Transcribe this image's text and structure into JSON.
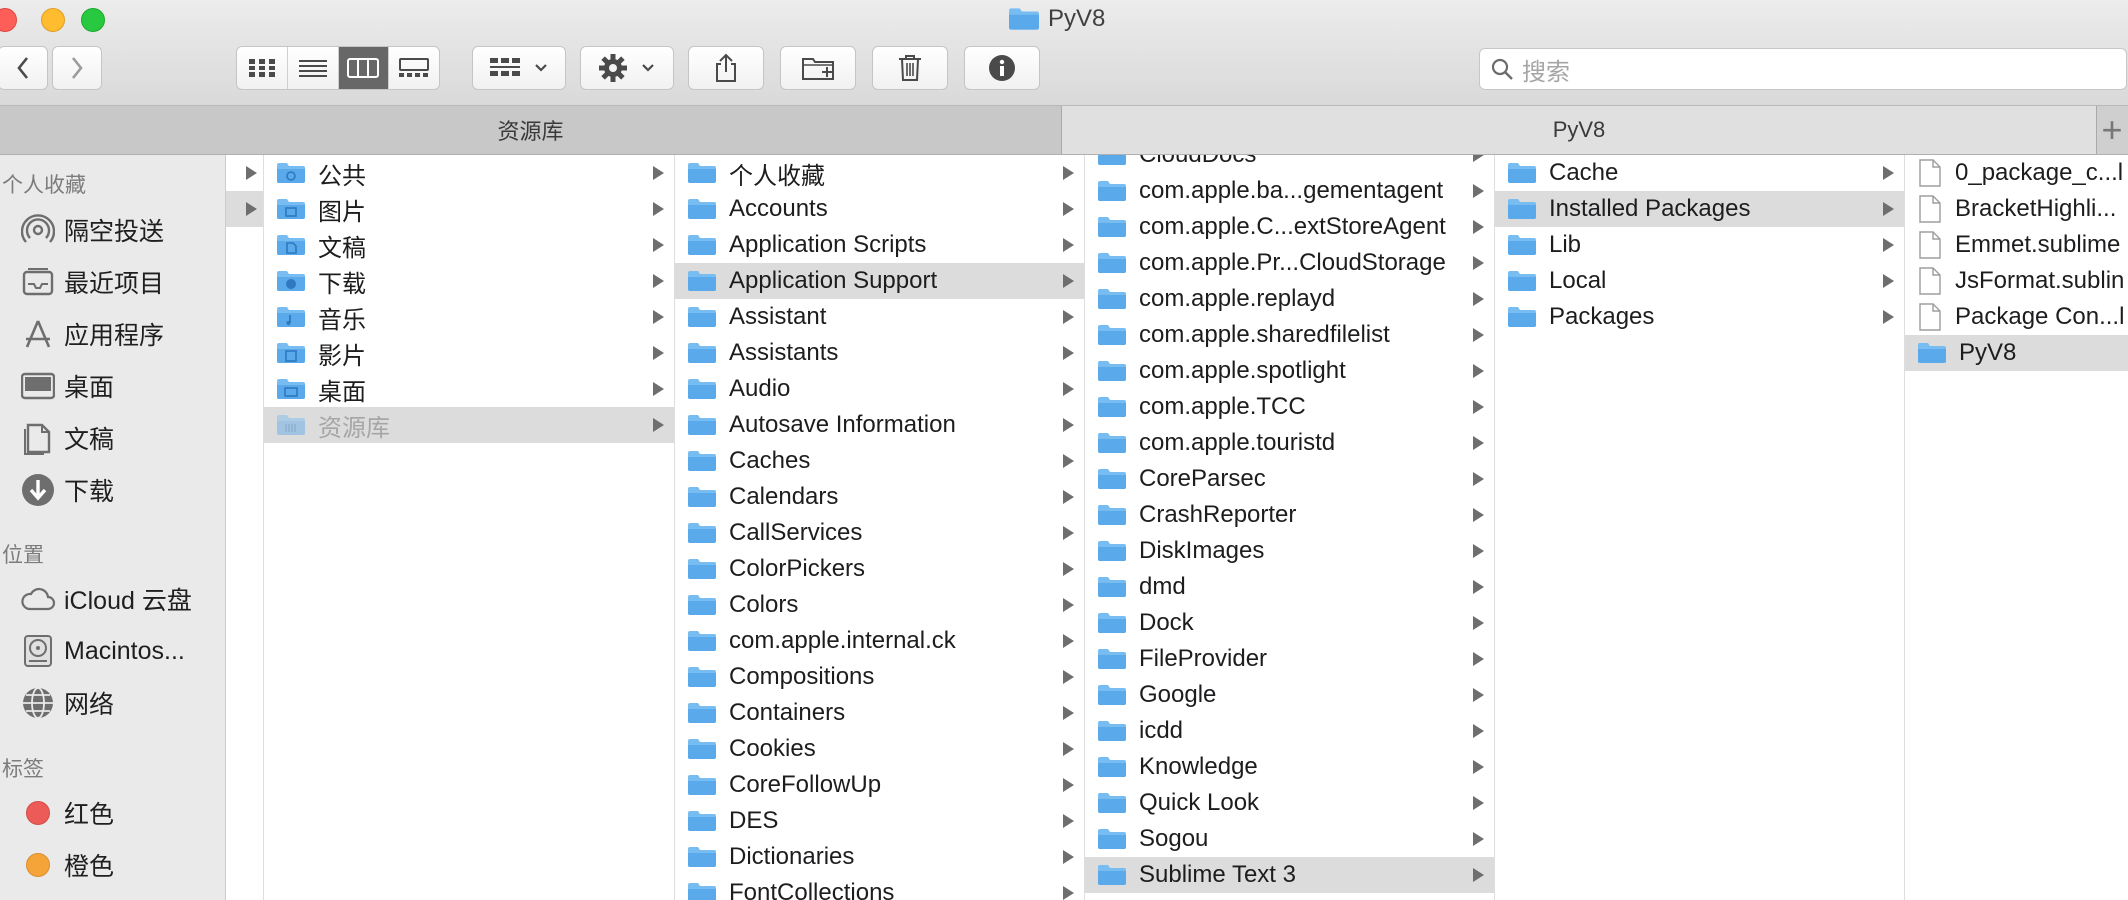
{
  "window": {
    "title": "PyV8"
  },
  "toolbar": {
    "view_modes": [
      "icon-view",
      "list-view",
      "column-view",
      "gallery-view"
    ],
    "active_view": "column-view",
    "search_placeholder": "搜索"
  },
  "tabs": [
    {
      "label": "资源库"
    },
    {
      "label": "PyV8"
    }
  ],
  "sidebar": {
    "favorites_title": "个人收藏",
    "favorites": [
      {
        "label": "隔空投送",
        "icon": "airdrop-icon"
      },
      {
        "label": "最近项目",
        "icon": "recents-icon"
      },
      {
        "label": "应用程序",
        "icon": "applications-icon"
      },
      {
        "label": "桌面",
        "icon": "desktop-icon"
      },
      {
        "label": "文稿",
        "icon": "documents-icon"
      },
      {
        "label": "下载",
        "icon": "downloads-icon"
      }
    ],
    "locations_title": "位置",
    "locations": [
      {
        "label": "iCloud 云盘",
        "icon": "icloud-icon"
      },
      {
        "label": "Macintos...",
        "icon": "harddisk-icon"
      },
      {
        "label": "网络",
        "icon": "network-icon"
      }
    ],
    "tags_title": "标签",
    "tags": [
      {
        "label": "红色",
        "color": "#ec5b57"
      },
      {
        "label": "橙色",
        "color": "#f5a43a"
      }
    ]
  },
  "columns": {
    "col1": [
      {
        "label": "",
        "arrow": true
      },
      {
        "label": "",
        "arrow": true,
        "selected": true
      }
    ],
    "col2": [
      {
        "label": "公共",
        "arrow": true
      },
      {
        "label": "图片",
        "arrow": true
      },
      {
        "label": "文稿",
        "arrow": true
      },
      {
        "label": "下载",
        "arrow": true
      },
      {
        "label": "音乐",
        "arrow": true
      },
      {
        "label": "影片",
        "arrow": true
      },
      {
        "label": "桌面",
        "arrow": true
      },
      {
        "label": "资源库",
        "arrow": true,
        "selected": true
      }
    ],
    "col3": [
      {
        "label": "个人收藏"
      },
      {
        "label": "Accounts"
      },
      {
        "label": "Application Scripts"
      },
      {
        "label": "Application Support",
        "selected": true
      },
      {
        "label": "Assistant"
      },
      {
        "label": "Assistants"
      },
      {
        "label": "Audio"
      },
      {
        "label": "Autosave Information"
      },
      {
        "label": "Caches"
      },
      {
        "label": "Calendars"
      },
      {
        "label": "CallServices"
      },
      {
        "label": "ColorPickers"
      },
      {
        "label": "Colors"
      },
      {
        "label": "com.apple.internal.ck"
      },
      {
        "label": "Compositions"
      },
      {
        "label": "Containers"
      },
      {
        "label": "Cookies"
      },
      {
        "label": "CoreFollowUp"
      },
      {
        "label": "DES"
      },
      {
        "label": "Dictionaries"
      },
      {
        "label": "FontCollections"
      }
    ],
    "col4": [
      {
        "label": "CloudDocs"
      },
      {
        "label": "com.apple.ba...gementagent"
      },
      {
        "label": "com.apple.C...extStoreAgent"
      },
      {
        "label": "com.apple.Pr...CloudStorage"
      },
      {
        "label": "com.apple.replayd"
      },
      {
        "label": "com.apple.sharedfilelist"
      },
      {
        "label": "com.apple.spotlight"
      },
      {
        "label": "com.apple.TCC"
      },
      {
        "label": "com.apple.touristd"
      },
      {
        "label": "CoreParsec"
      },
      {
        "label": "CrashReporter"
      },
      {
        "label": "DiskImages"
      },
      {
        "label": "dmd"
      },
      {
        "label": "Dock"
      },
      {
        "label": "FileProvider"
      },
      {
        "label": "Google"
      },
      {
        "label": "icdd"
      },
      {
        "label": "Knowledge"
      },
      {
        "label": "Quick Look"
      },
      {
        "label": "Sogou"
      },
      {
        "label": "Sublime Text 3",
        "selected": true
      }
    ],
    "col5": [
      {
        "label": "Cache"
      },
      {
        "label": "Installed Packages",
        "selected": true
      },
      {
        "label": "Lib"
      },
      {
        "label": "Local"
      },
      {
        "label": "Packages"
      }
    ],
    "col6": [
      {
        "label": "0_package_c...l",
        "type": "file"
      },
      {
        "label": "BracketHighli...",
        "type": "file"
      },
      {
        "label": "Emmet.sublime",
        "type": "file"
      },
      {
        "label": "JsFormat.sublin",
        "type": "file"
      },
      {
        "label": "Package Con...l",
        "type": "file"
      },
      {
        "label": "PyV8",
        "type": "folder",
        "selected": true
      }
    ]
  }
}
